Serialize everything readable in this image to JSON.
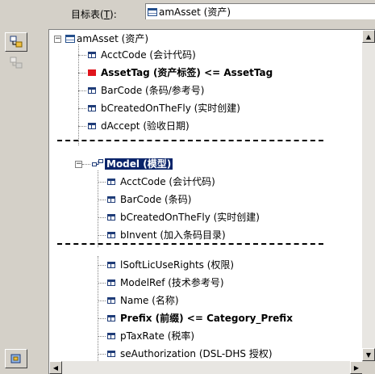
{
  "header": {
    "label_pre": "目标表(",
    "label_key": "T",
    "label_post": "):",
    "value": "amAsset (资产)"
  },
  "tree": {
    "root_label": "amAsset (资产)",
    "group1": [
      {
        "label": "AcctCode (会计代码)",
        "bold": false
      },
      {
        "label": "AssetTag (资产标签)  <=  AssetTag",
        "bold": true,
        "red": true
      },
      {
        "label": "BarCode (条码/参考号)",
        "bold": false
      },
      {
        "label": "bCreatedOnTheFly (实时创建)",
        "bold": false
      },
      {
        "label": "dAccept (验收日期)",
        "bold": false
      }
    ],
    "model_label": "Model (模型)",
    "group2": [
      {
        "label": "AcctCode (会计代码)"
      },
      {
        "label": "BarCode (条码)"
      },
      {
        "label": "bCreatedOnTheFly (实时创建)"
      },
      {
        "label": "bInvent (加入条码目录)"
      }
    ],
    "group3": [
      {
        "label": "lSoftLicUseRights (权限)",
        "bold": false
      },
      {
        "label": "ModelRef (技术参考号)",
        "bold": false
      },
      {
        "label": "Name (名称)",
        "bold": false
      },
      {
        "label": "Prefix (前缀)  <=  Category_Prefix",
        "bold": true
      },
      {
        "label": "pTaxRate (税率)",
        "bold": false
      },
      {
        "label": "seAuthorization (DSL-DHS 授权)",
        "bold": false
      }
    ]
  }
}
